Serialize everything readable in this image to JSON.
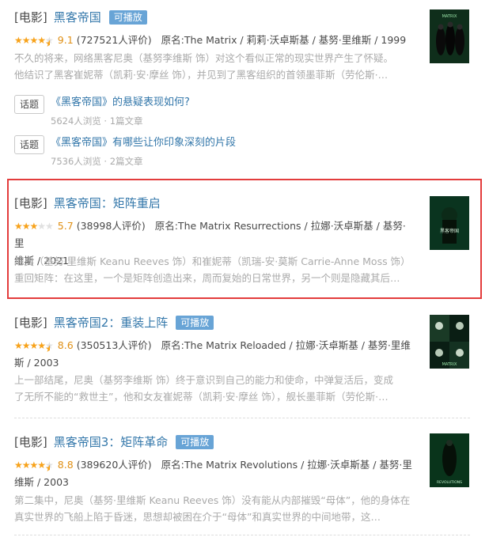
{
  "results": [
    {
      "category": "[电影]",
      "title": "黑客帝国",
      "badge": "可播放",
      "rating": "9.1",
      "stars": 4.5,
      "votes": "(727521人评价)",
      "meta_line1": "原名:The Matrix / 莉莉·沃卓斯基 / 基努·里维斯 / 1999",
      "meta_line2": "",
      "desc_line1": "不久的将来，网络黑客尼奥（基努李维斯 饰）对这个看似正常的现实世界产生了怀疑。",
      "desc_line2": "他结识了黑客崔妮蒂（凯莉·安·摩丝 饰），并见到了黑客组织的首领墨菲斯（劳伦斯·…",
      "poster_text": "MATRIX"
    },
    {
      "category": "[电影]",
      "title": "黑客帝国：矩阵重启",
      "badge": "",
      "rating": "5.7",
      "stars": 3,
      "votes": "(38998人评价)",
      "meta_line1": "原名:The Matrix Resurrections / 拉娜·沃卓斯基 / 基努·里",
      "meta_line2": "维斯 / 2021",
      "desc_line1": "尼奥（基努·里维斯 Keanu Reeves 饰）和崔妮蒂（凯瑞-安·莫斯 Carrie-Anne Moss 饰）",
      "desc_line2": "重回矩阵：在这里，一个是矩阵创造出来，周而复始的日常世界，另一个则是隐藏其后…",
      "poster_text": "黑客帝国"
    },
    {
      "category": "[电影]",
      "title": "黑客帝国2：重装上阵",
      "badge": "可播放",
      "rating": "8.6",
      "stars": 4.5,
      "votes": "(350513人评价)",
      "meta_line1": "原名:The Matrix Reloaded / 拉娜·沃卓斯基 / 基努·里维",
      "meta_line2": "斯 / 2003",
      "desc_line1": "上一部结尾，尼奥（基努李维斯 饰）终于意识到自己的能力和使命，中弹复活后，变成",
      "desc_line2": "了无所不能的“救世主”，他和女友崔妮蒂（凯莉·安·摩丝 饰），舰长墨菲斯（劳伦斯·…",
      "poster_text": "MATRIX"
    },
    {
      "category": "[电影]",
      "title": "黑客帝国3：矩阵革命",
      "badge": "可播放",
      "rating": "8.8",
      "stars": 4.5,
      "votes": "(389620人评价)",
      "meta_line1": "原名:The Matrix Revolutions / 拉娜·沃卓斯基 / 基努·里",
      "meta_line2": "维斯 / 2003",
      "desc_line1": "第二集中，尼奥（基努·里维斯 Keanu Reeves 饰）没有能从内部摧毁“母体”，他的身体在",
      "desc_line2": "真实世界的飞船上陷于昏迷，思想却被困在介于“母体”和真实世界的中间地带，这…",
      "poster_text": "REVOLUTIONS"
    }
  ],
  "topics": [
    {
      "tag": "话题",
      "title": "《黑客帝国》的悬疑表现如何?",
      "stats": "5624人浏览 · 1篇文章"
    },
    {
      "tag": "话题",
      "title": "《黑客帝国》有哪些让你印象深刻的片段",
      "stats": "7536人浏览 · 2篇文章"
    }
  ],
  "colors": {
    "link": "#3377aa",
    "badge": "#68a4d6",
    "star": "#f7a21a",
    "highlight": "#e33c3c"
  }
}
